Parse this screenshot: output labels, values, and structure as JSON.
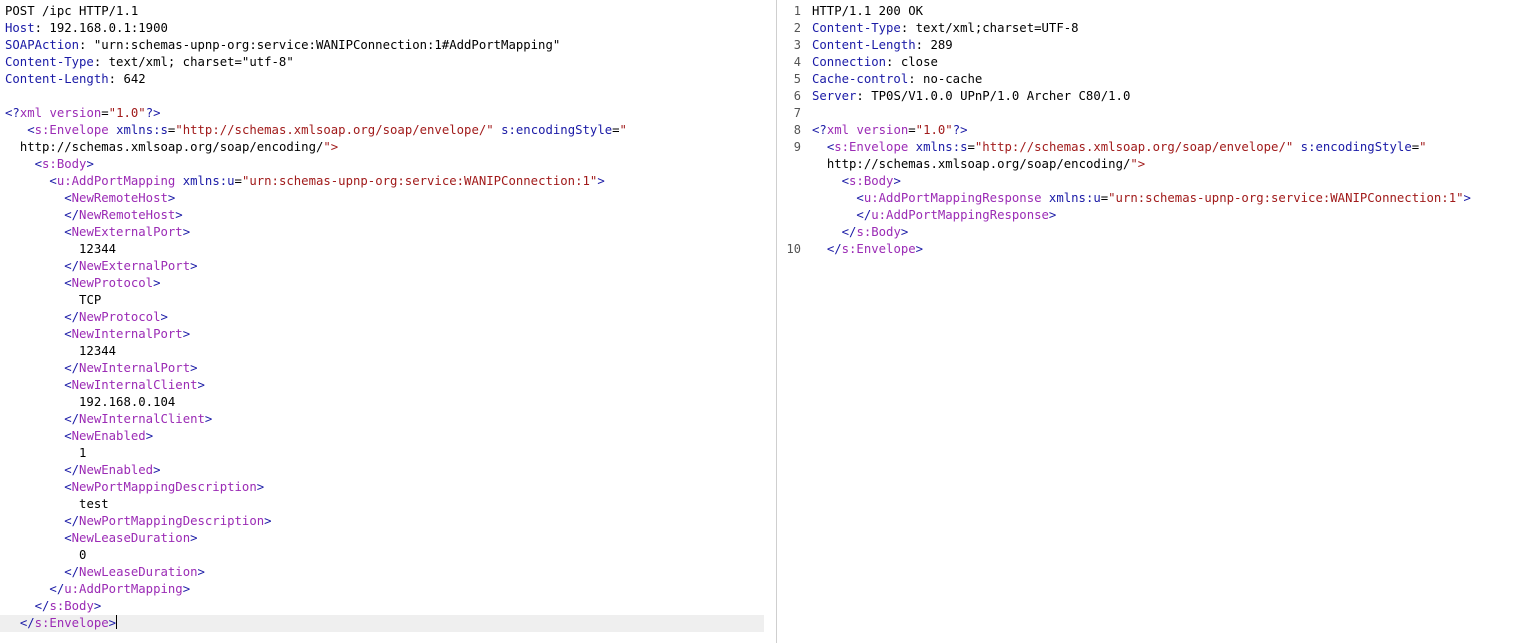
{
  "request": {
    "headers": [
      {
        "text": "POST /ipc HTTP/1.1"
      },
      {
        "name": "Host",
        "value": ": 192.168.0.1:1900"
      },
      {
        "name": "SOAPAction",
        "value": ": \"urn:schemas-upnp-org:service:WANIPConnection:1#AddPortMapping\""
      },
      {
        "name": "Content-Type",
        "value": ": text/xml; charset=\"utf-8\""
      },
      {
        "name": "Content-Length",
        "value": ": 642"
      }
    ],
    "body_lines": [
      "",
      "<?xml version=\"1.0\"?>",
      "   <s:Envelope xmlns:s=\"http://schemas.xmlsoap.org/soap/envelope/\" s:encodingStyle=\"",
      "  http://schemas.xmlsoap.org/soap/encoding/\">",
      "    <s:Body>",
      "      <u:AddPortMapping xmlns:u=\"urn:schemas-upnp-org:service:WANIPConnection:1\">",
      "        <NewRemoteHost>",
      "        </NewRemoteHost>",
      "        <NewExternalPort>",
      "          12344",
      "        </NewExternalPort>",
      "        <NewProtocol>",
      "          TCP",
      "        </NewProtocol>",
      "        <NewInternalPort>",
      "          12344",
      "        </NewInternalPort>",
      "        <NewInternalClient>",
      "          192.168.0.104",
      "        </NewInternalClient>",
      "        <NewEnabled>",
      "          1",
      "        </NewEnabled>",
      "        <NewPortMappingDescription>",
      "          test",
      "        </NewPortMappingDescription>",
      "        <NewLeaseDuration>",
      "          0",
      "        </NewLeaseDuration>",
      "      </u:AddPortMapping>",
      "    </s:Body>",
      "  </s:Envelope>"
    ]
  },
  "response": {
    "line_numbers": [
      "1",
      "2",
      "3",
      "4",
      "5",
      "6",
      "7",
      "8",
      "9",
      "",
      "",
      "",
      "",
      "",
      "10"
    ],
    "headers": [
      {
        "text": "HTTP/1.1 200 OK"
      },
      {
        "name": "Content-Type",
        "value": ": text/xml;charset=UTF-8"
      },
      {
        "name": "Content-Length",
        "value": ": 289"
      },
      {
        "name": "Connection",
        "value": ": close"
      },
      {
        "name": "Cache-control",
        "value": ": no-cache"
      },
      {
        "name": "Server",
        "value": ": TP0S/V1.0.0 UPnP/1.0 Archer C80/1.0"
      }
    ],
    "body_lines": [
      "",
      "<?xml version=\"1.0\"?>",
      "  <s:Envelope xmlns:s=\"http://schemas.xmlsoap.org/soap/envelope/\" s:encodingStyle=\"",
      "  http://schemas.xmlsoap.org/soap/encoding/\">",
      "    <s:Body>",
      "      <u:AddPortMappingResponse xmlns:u=\"urn:schemas-upnp-org:service:WANIPConnection:1\">",
      "      </u:AddPortMappingResponse>",
      "    </s:Body>",
      "  </s:Envelope>",
      ""
    ]
  },
  "colors": {
    "header_name": "#1a1aa6",
    "xml_bracket": "#1a1aa6",
    "xml_string": "#a11b1b",
    "xml_tag": "#9b2bb5",
    "current_line": "#efefef"
  }
}
